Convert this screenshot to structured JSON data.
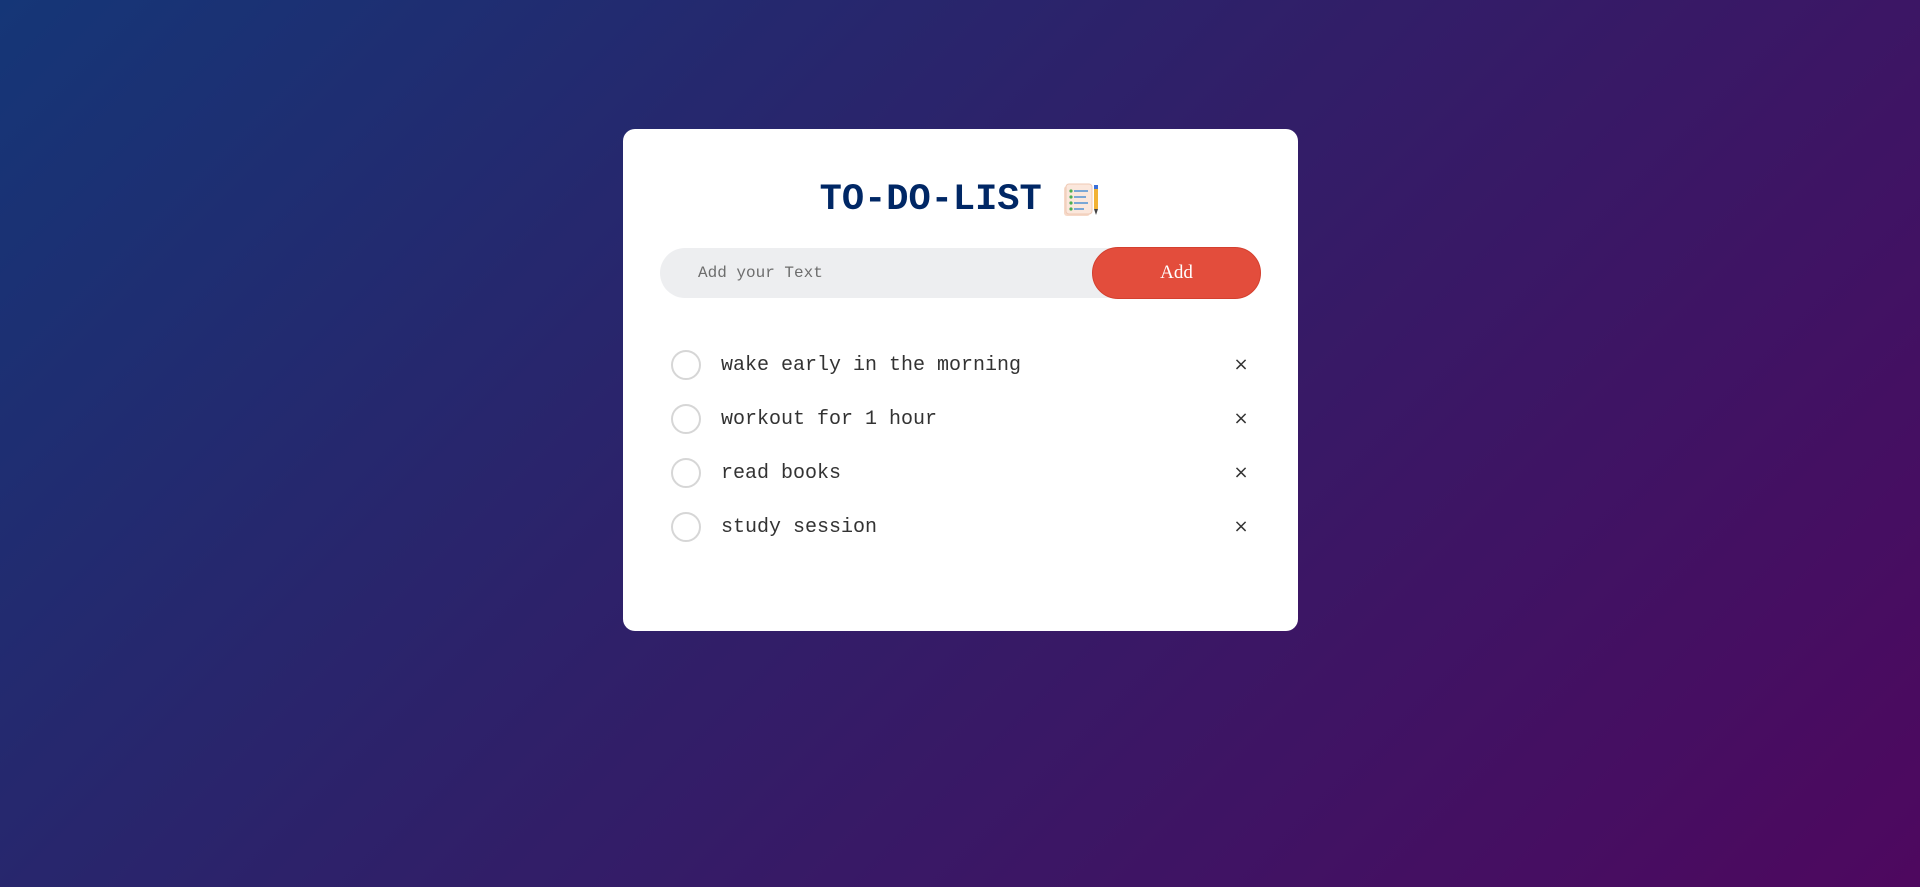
{
  "app": {
    "title": "TO-DO-LIST",
    "title_icon": "notepad-checklist-icon",
    "colors": {
      "background_start": "#153677",
      "background_end": "#4e085f",
      "title": "#002765",
      "add_button": "#e34d3c",
      "input_background": "#edeef0"
    }
  },
  "input": {
    "placeholder": "Add your Text",
    "value": ""
  },
  "add_button": {
    "label": "Add"
  },
  "todos": [
    {
      "text": "wake early in the morning",
      "checked": false,
      "delete_glyph": "×"
    },
    {
      "text": "workout for 1 hour",
      "checked": false,
      "delete_glyph": "×"
    },
    {
      "text": "read books",
      "checked": false,
      "delete_glyph": "×"
    },
    {
      "text": "study session",
      "checked": false,
      "delete_glyph": "×"
    }
  ]
}
